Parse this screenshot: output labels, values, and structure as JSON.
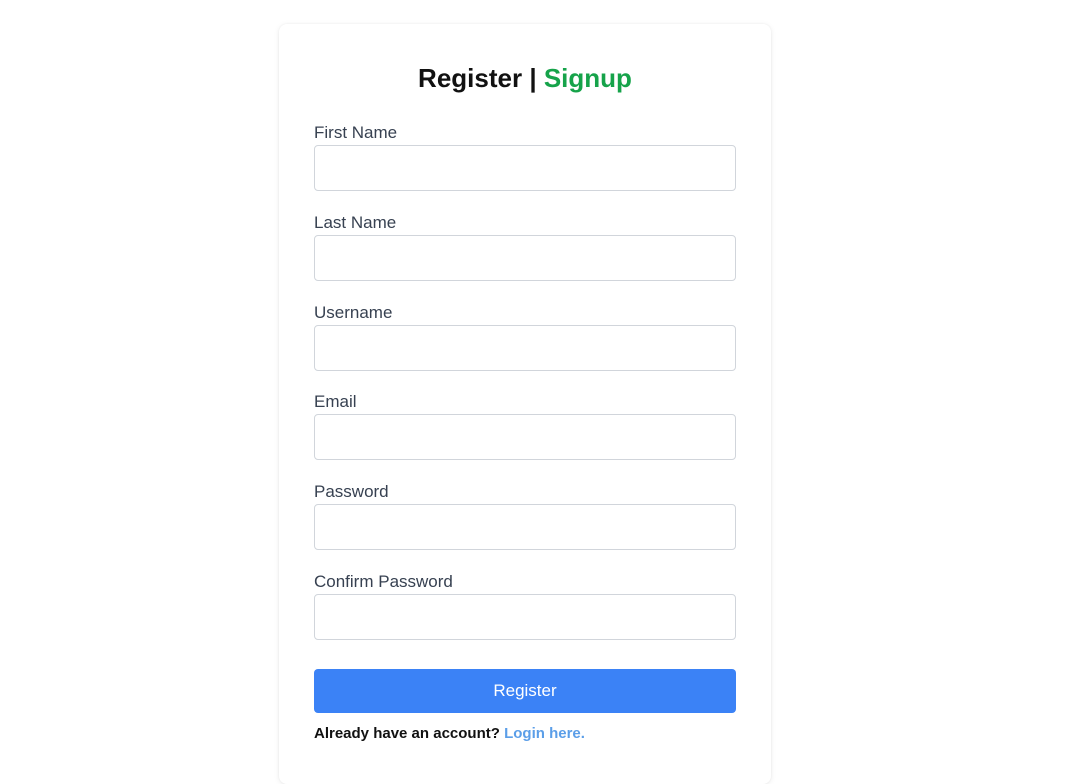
{
  "form": {
    "title_main": "Register",
    "title_separator": "|",
    "title_accent": "Signup",
    "fields": [
      {
        "label": "First Name",
        "value": "",
        "type": "text"
      },
      {
        "label": "Last Name",
        "value": "",
        "type": "text"
      },
      {
        "label": "Username",
        "value": "",
        "type": "text"
      },
      {
        "label": "Email",
        "value": "",
        "type": "email"
      },
      {
        "label": "Password",
        "value": "",
        "type": "password"
      },
      {
        "label": "Confirm Password",
        "value": "",
        "type": "password"
      }
    ],
    "submit_label": "Register",
    "footer_text": "Already have an account?",
    "footer_link": "Login here."
  },
  "colors": {
    "accent": "#16a34a",
    "button": "#3b82f6",
    "link": "#5b9ee8"
  }
}
